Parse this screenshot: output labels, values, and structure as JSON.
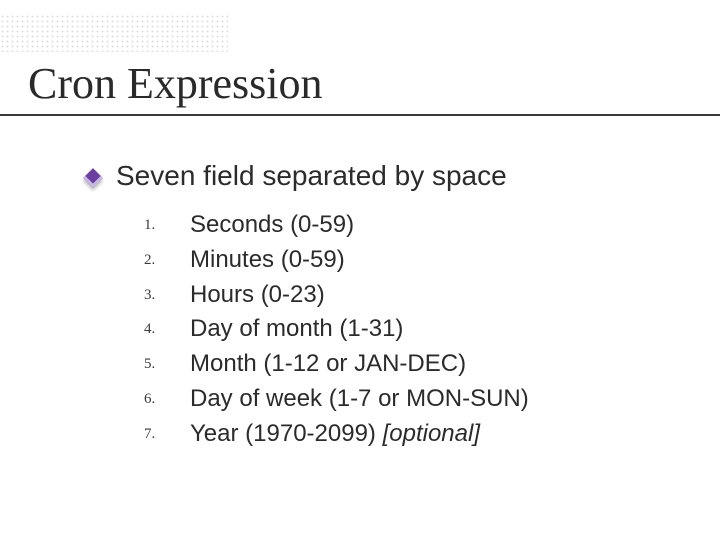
{
  "title": "Cron Expression",
  "lead": "Seven field separated by space",
  "fields": [
    {
      "text": "Seconds (0-59)"
    },
    {
      "text": "Minutes (0-59)"
    },
    {
      "text": "Hours (0-23)"
    },
    {
      "text": "Day of month (1-31)"
    },
    {
      "text": "Month (1-12 or JAN-DEC)"
    },
    {
      "text": "Day of week (1-7 or MON-SUN)"
    },
    {
      "text": "Year (1970-2099) ",
      "suffix_italic": "[optional]"
    }
  ]
}
